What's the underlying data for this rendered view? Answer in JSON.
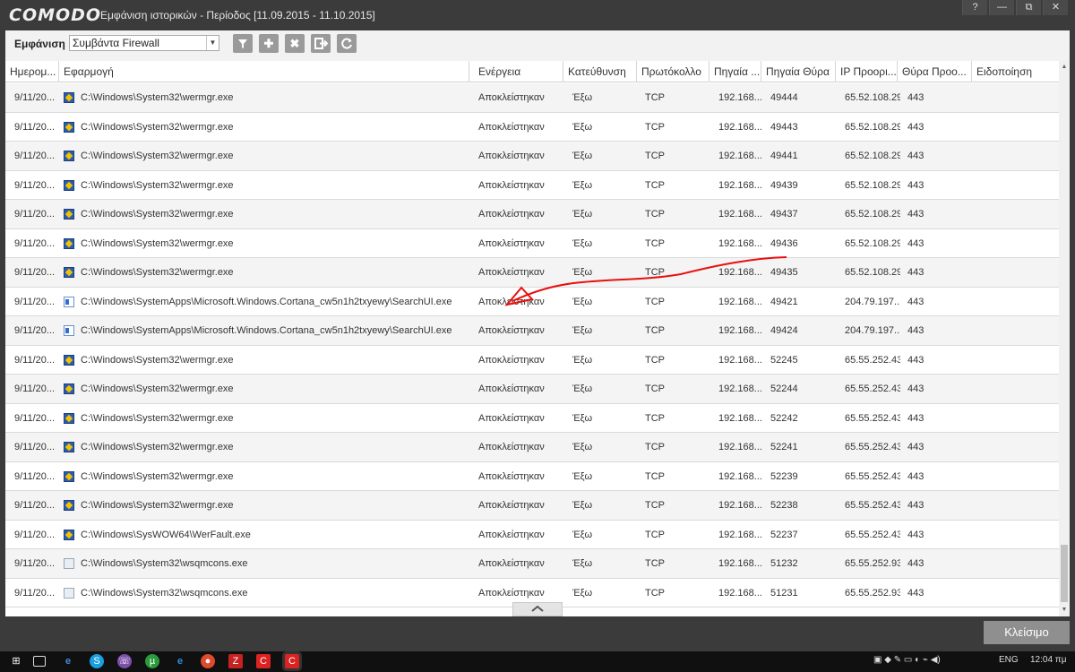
{
  "window": {
    "logo": "COMODO",
    "title": "Εμφάνιση ιστορικών - Περίοδος [11.09.2015 - 11.10.2015]",
    "buttons": [
      "?",
      "—",
      "⧉",
      "✕"
    ]
  },
  "toolbar": {
    "view_label": "Εμφάνιση",
    "view_select": "Συμβάντα Firewall",
    "icons": [
      "filter-icon",
      "add-icon",
      "remove-icon",
      "export-icon",
      "refresh-icon"
    ]
  },
  "columns": [
    "Ημερομ...",
    "Εφαρμογή",
    "Ενέργεια",
    "Κατεύθυνση",
    "Πρωτόκολλο",
    "Πηγαία ...",
    "Πηγαία Θύρα",
    "IP Προορι...",
    "Θύρα Προο...",
    "Ειδοποίηση"
  ],
  "rows": [
    {
      "date": "9/11/20...",
      "icon": "wer",
      "app": "C:\\Windows\\System32\\wermgr.exe",
      "action": "Αποκλείστηκαν",
      "dir": "Έξω",
      "proto": "TCP",
      "src": "192.168...",
      "sport": "49444",
      "dst": "65.52.108.29",
      "dport": "443",
      "notif": ""
    },
    {
      "date": "9/11/20...",
      "icon": "wer",
      "app": "C:\\Windows\\System32\\wermgr.exe",
      "action": "Αποκλείστηκαν",
      "dir": "Έξω",
      "proto": "TCP",
      "src": "192.168...",
      "sport": "49443",
      "dst": "65.52.108.29",
      "dport": "443",
      "notif": ""
    },
    {
      "date": "9/11/20...",
      "icon": "wer",
      "app": "C:\\Windows\\System32\\wermgr.exe",
      "action": "Αποκλείστηκαν",
      "dir": "Έξω",
      "proto": "TCP",
      "src": "192.168...",
      "sport": "49441",
      "dst": "65.52.108.29",
      "dport": "443",
      "notif": ""
    },
    {
      "date": "9/11/20...",
      "icon": "wer",
      "app": "C:\\Windows\\System32\\wermgr.exe",
      "action": "Αποκλείστηκαν",
      "dir": "Έξω",
      "proto": "TCP",
      "src": "192.168...",
      "sport": "49439",
      "dst": "65.52.108.29",
      "dport": "443",
      "notif": ""
    },
    {
      "date": "9/11/20...",
      "icon": "wer",
      "app": "C:\\Windows\\System32\\wermgr.exe",
      "action": "Αποκλείστηκαν",
      "dir": "Έξω",
      "proto": "TCP",
      "src": "192.168...",
      "sport": "49437",
      "dst": "65.52.108.29",
      "dport": "443",
      "notif": ""
    },
    {
      "date": "9/11/20...",
      "icon": "wer",
      "app": "C:\\Windows\\System32\\wermgr.exe",
      "action": "Αποκλείστηκαν",
      "dir": "Έξω",
      "proto": "TCP",
      "src": "192.168...",
      "sport": "49436",
      "dst": "65.52.108.29",
      "dport": "443",
      "notif": ""
    },
    {
      "date": "9/11/20...",
      "icon": "wer",
      "app": "C:\\Windows\\System32\\wermgr.exe",
      "action": "Αποκλείστηκαν",
      "dir": "Έξω",
      "proto": "TCP",
      "src": "192.168...",
      "sport": "49435",
      "dst": "65.52.108.29",
      "dport": "443",
      "notif": ""
    },
    {
      "date": "9/11/20...",
      "icon": "ui",
      "app": "C:\\Windows\\SystemApps\\Microsoft.Windows.Cortana_cw5n1h2txyewy\\SearchUI.exe",
      "action": "Αποκλείστηκαν",
      "dir": "Έξω",
      "proto": "TCP",
      "src": "192.168...",
      "sport": "49421",
      "dst": "204.79.197...",
      "dport": "443",
      "notif": ""
    },
    {
      "date": "9/11/20...",
      "icon": "ui",
      "app": "C:\\Windows\\SystemApps\\Microsoft.Windows.Cortana_cw5n1h2txyewy\\SearchUI.exe",
      "action": "Αποκλείστηκαν",
      "dir": "Έξω",
      "proto": "TCP",
      "src": "192.168...",
      "sport": "49424",
      "dst": "204.79.197...",
      "dport": "443",
      "notif": ""
    },
    {
      "date": "9/11/20...",
      "icon": "wer",
      "app": "C:\\Windows\\System32\\wermgr.exe",
      "action": "Αποκλείστηκαν",
      "dir": "Έξω",
      "proto": "TCP",
      "src": "192.168...",
      "sport": "52245",
      "dst": "65.55.252.43",
      "dport": "443",
      "notif": ""
    },
    {
      "date": "9/11/20...",
      "icon": "wer",
      "app": "C:\\Windows\\System32\\wermgr.exe",
      "action": "Αποκλείστηκαν",
      "dir": "Έξω",
      "proto": "TCP",
      "src": "192.168...",
      "sport": "52244",
      "dst": "65.55.252.43",
      "dport": "443",
      "notif": ""
    },
    {
      "date": "9/11/20...",
      "icon": "wer",
      "app": "C:\\Windows\\System32\\wermgr.exe",
      "action": "Αποκλείστηκαν",
      "dir": "Έξω",
      "proto": "TCP",
      "src": "192.168...",
      "sport": "52242",
      "dst": "65.55.252.43",
      "dport": "443",
      "notif": ""
    },
    {
      "date": "9/11/20...",
      "icon": "wer",
      "app": "C:\\Windows\\System32\\wermgr.exe",
      "action": "Αποκλείστηκαν",
      "dir": "Έξω",
      "proto": "TCP",
      "src": "192.168...",
      "sport": "52241",
      "dst": "65.55.252.43",
      "dport": "443",
      "notif": ""
    },
    {
      "date": "9/11/20...",
      "icon": "wer",
      "app": "C:\\Windows\\System32\\wermgr.exe",
      "action": "Αποκλείστηκαν",
      "dir": "Έξω",
      "proto": "TCP",
      "src": "192.168...",
      "sport": "52239",
      "dst": "65.55.252.43",
      "dport": "443",
      "notif": ""
    },
    {
      "date": "9/11/20...",
      "icon": "wer",
      "app": "C:\\Windows\\System32\\wermgr.exe",
      "action": "Αποκλείστηκαν",
      "dir": "Έξω",
      "proto": "TCP",
      "src": "192.168...",
      "sport": "52238",
      "dst": "65.55.252.43",
      "dport": "443",
      "notif": ""
    },
    {
      "date": "9/11/20...",
      "icon": "wer",
      "app": "C:\\Windows\\SysWOW64\\WerFault.exe",
      "action": "Αποκλείστηκαν",
      "dir": "Έξω",
      "proto": "TCP",
      "src": "192.168...",
      "sport": "52237",
      "dst": "65.55.252.43",
      "dport": "443",
      "notif": ""
    },
    {
      "date": "9/11/20...",
      "icon": "doc",
      "app": "C:\\Windows\\System32\\wsqmcons.exe",
      "action": "Αποκλείστηκαν",
      "dir": "Έξω",
      "proto": "TCP",
      "src": "192.168...",
      "sport": "51232",
      "dst": "65.55.252.93",
      "dport": "443",
      "notif": ""
    },
    {
      "date": "9/11/20...",
      "icon": "doc",
      "app": "C:\\Windows\\System32\\wsqmcons.exe",
      "action": "Αποκλείστηκαν",
      "dir": "Έξω",
      "proto": "TCP",
      "src": "192.168...",
      "sport": "51231",
      "dst": "65.55.252.93",
      "dport": "443",
      "notif": ""
    }
  ],
  "footer": {
    "close_label": "Κλείσιμο"
  },
  "taskbar": {
    "apps": [
      "start-icon",
      "task-view-icon",
      "edge-icon",
      "skype-icon",
      "viber-icon",
      "utorrent-icon",
      "ie-icon",
      "chrome-icon",
      "filezilla-icon",
      "comodo-icon",
      "comodo-active-icon"
    ],
    "lang": "ENG",
    "time": "12:04 πμ"
  }
}
